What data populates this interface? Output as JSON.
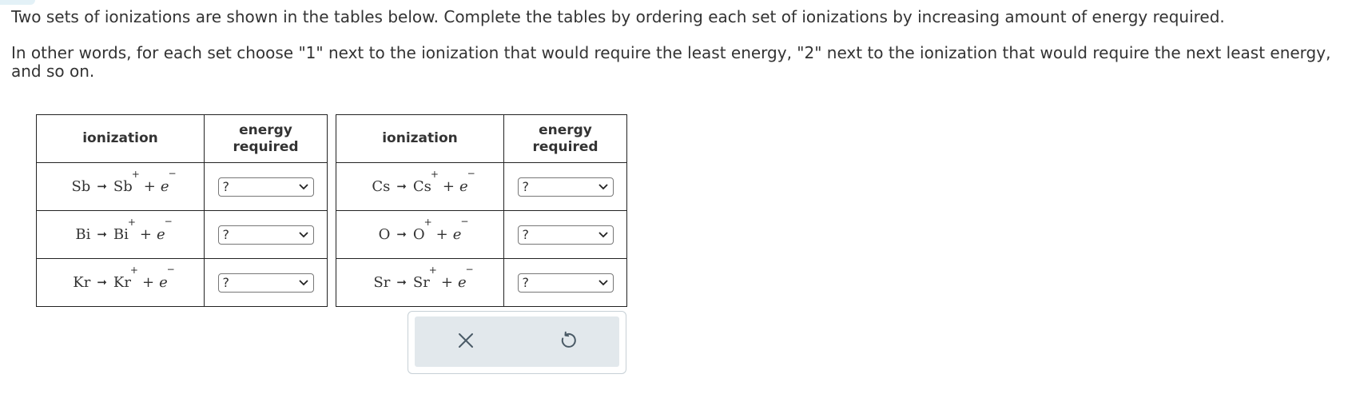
{
  "instructions": {
    "line1": "Two sets of ionizations are shown in the tables below. Complete the tables by ordering each set of ionizations by increasing amount of energy required.",
    "line2": "In other words, for each set choose \"1\" next to the ionization that would require the least energy, \"2\" next to the ionization that would require the next least energy, and so on."
  },
  "tables": [
    {
      "headers": {
        "ionization": "ionization",
        "energy_line1": "energy",
        "energy_line2": "required"
      },
      "rows": [
        {
          "atom": "Sb",
          "ion": "Sb",
          "charge": "+",
          "electron": "e",
          "electron_charge": "−",
          "selected": "?"
        },
        {
          "atom": "Bi",
          "ion": "Bi",
          "charge": "+",
          "electron": "e",
          "electron_charge": "−",
          "selected": "?"
        },
        {
          "atom": "Kr",
          "ion": "Kr",
          "charge": "+",
          "electron": "e",
          "electron_charge": "−",
          "selected": "?"
        }
      ]
    },
    {
      "headers": {
        "ionization": "ionization",
        "energy_line1": "energy",
        "energy_line2": "required"
      },
      "rows": [
        {
          "atom": "Cs",
          "ion": "Cs",
          "charge": "+",
          "electron": "e",
          "electron_charge": "−",
          "selected": "?"
        },
        {
          "atom": "O",
          "ion": "O",
          "charge": "+",
          "electron": "e",
          "electron_charge": "−",
          "selected": "?"
        },
        {
          "atom": "Sr",
          "ion": "Sr",
          "charge": "+",
          "electron": "e",
          "electron_charge": "−",
          "selected": "?"
        }
      ]
    }
  ],
  "symbols": {
    "arrow": "➞",
    "plus": "+",
    "chevron": "∨"
  },
  "actions": {
    "clear_icon": "close-icon",
    "undo_icon": "undo-icon"
  },
  "colors": {
    "panel_bg": "#e2e8ec",
    "icon": "#4a5a66"
  }
}
